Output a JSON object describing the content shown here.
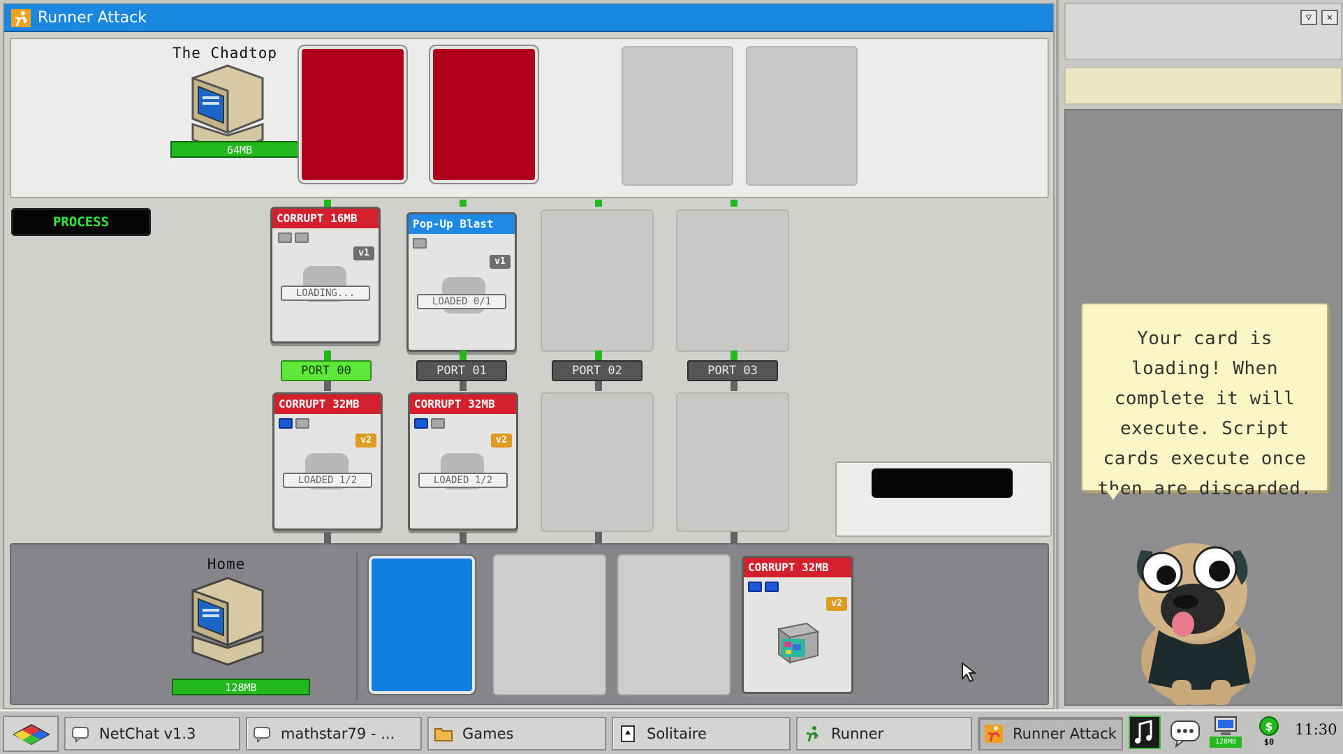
{
  "window": {
    "title": "Runner Attack",
    "controls": {
      "minimize": "▽",
      "close": "✕"
    }
  },
  "opponent": {
    "name": "The Chadtop",
    "memory": "64MB",
    "hand_slots": [
      "red-card",
      "red-card",
      "empty",
      "empty"
    ]
  },
  "process_button": "PROCESS",
  "ports": [
    "PORT 00",
    "PORT 01",
    "PORT 02",
    "PORT 03"
  ],
  "active_port": "PORT 00",
  "opponent_cards": [
    {
      "title": "CORRUPT 16MB",
      "header_color": "#d41f2c",
      "pips_on": 0,
      "pips_total": 2,
      "version": "v1",
      "status": "LOADING..."
    },
    {
      "title": "Pop-Up Blast",
      "header_color": "#1e8ae6",
      "pips_on": 0,
      "pips_total": 1,
      "version": "v1",
      "status": "LOADED 0/1"
    }
  ],
  "player_cards": [
    {
      "title": "CORRUPT 32MB",
      "header_color": "#d41f2c",
      "pips_on": 1,
      "pips_total": 2,
      "version": "v2",
      "status": "LOADED 1/2"
    },
    {
      "title": "CORRUPT 32MB",
      "header_color": "#d41f2c",
      "pips_on": 1,
      "pips_total": 2,
      "version": "v2",
      "status": "LOADED 1/2"
    }
  ],
  "home": {
    "name": "Home",
    "memory": "128MB",
    "hand_slots": [
      "blue-card",
      "empty",
      "empty",
      "card"
    ],
    "hand_card": {
      "title": "CORRUPT 32MB",
      "pips_on": 2,
      "pips_total": 2,
      "version": "v2"
    }
  },
  "assistant": {
    "message": "Your card is loading! When complete it will execute. Script cards execute once then are discarded."
  },
  "taskbar": {
    "items": [
      {
        "label": "NetChat v1.3",
        "icon": "chat-bubble-icon",
        "active": false
      },
      {
        "label": "mathstar79 - ...",
        "icon": "chat-bubble-icon",
        "active": false
      },
      {
        "label": "Games",
        "icon": "folder-icon",
        "active": false
      },
      {
        "label": "Solitaire",
        "icon": "solitaire-icon",
        "active": false
      },
      {
        "label": "Runner",
        "icon": "runner-icon",
        "active": false
      },
      {
        "label": "Runner Attack",
        "icon": "runner-attack-icon",
        "active": true
      }
    ],
    "tray": {
      "memory_label": "128MB",
      "money_label": "$0",
      "clock": "11:30"
    }
  },
  "colors": {
    "title_bar": "#1a88e0",
    "opponent_card_back": "#b0001e",
    "player_card_back": "#0f7ee0",
    "memory_bar": "#22b81e",
    "active_port": "#5ee83a",
    "speech_bubble": "#fcf5c6"
  }
}
